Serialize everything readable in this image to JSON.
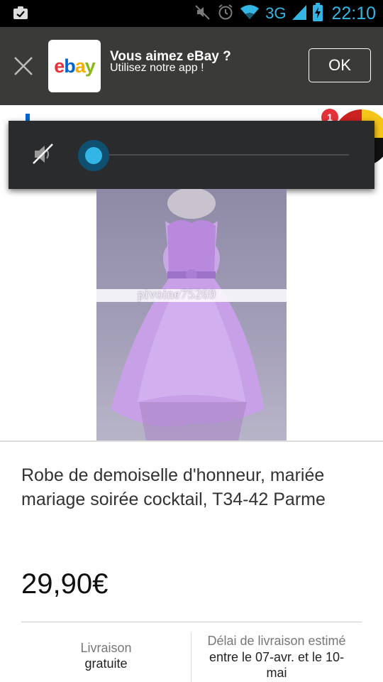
{
  "status_bar": {
    "network": "3G",
    "time": "22:10",
    "icons": [
      "clipboard-check-icon",
      "mute-icon",
      "alarm-icon",
      "wifi-icon",
      "signal-icon",
      "battery-charging-icon"
    ],
    "accent_color": "#33b5e5"
  },
  "banner": {
    "logo_letters": [
      "e",
      "b",
      "a",
      "y"
    ],
    "logo_colors": [
      "#e53238",
      "#0064d2",
      "#f5af02",
      "#86b817"
    ],
    "title": "Vous aimez eBay ?",
    "subtitle": "Utilisez notre app !",
    "ok_label": "OK"
  },
  "header": {
    "cart_badge": "1"
  },
  "volume_overlay": {
    "level": 0,
    "muted": true
  },
  "product": {
    "watermark": "pivoine75269",
    "title": "Robe de demoiselle d'honneur, mariée mariage soirée cocktail, T34-42 Parme",
    "price": "29,90€",
    "shipping_label": "Livraison",
    "shipping_value": "gratuite",
    "delivery_label": "Délai de livraison estimé",
    "delivery_value": "entre le 07-avr. et le 10-mai"
  }
}
